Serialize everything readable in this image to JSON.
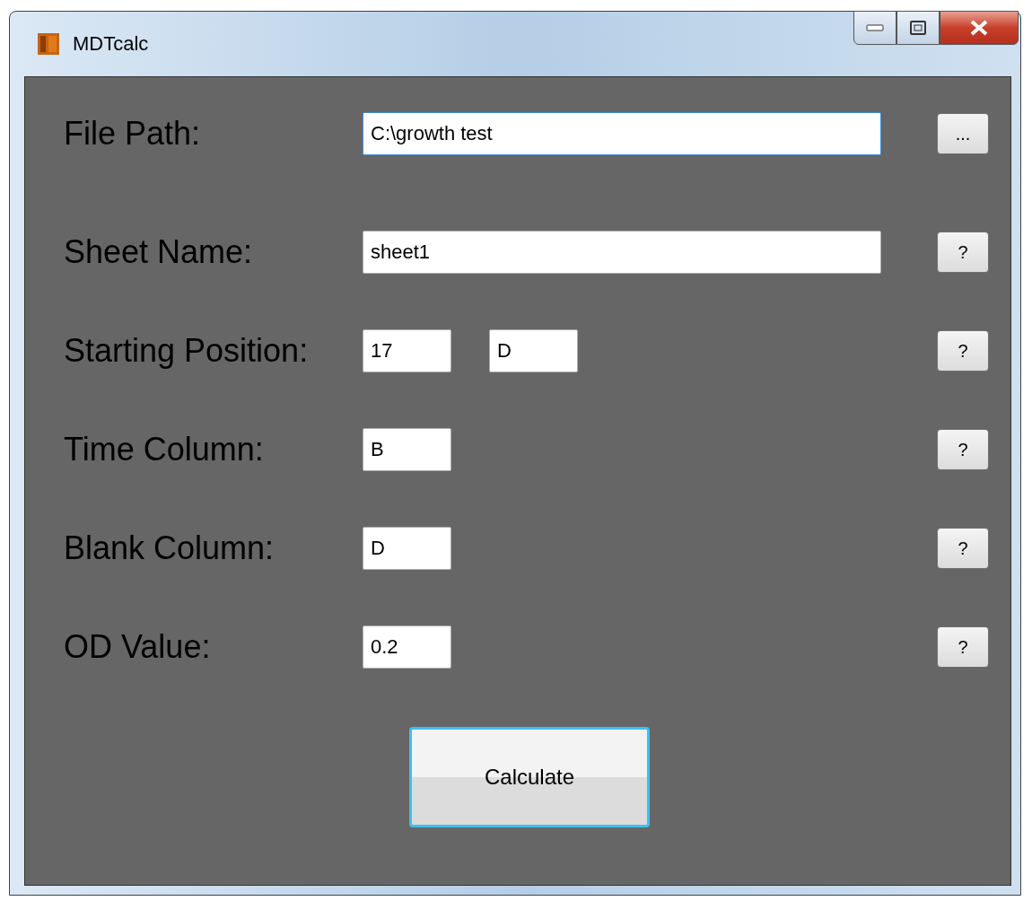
{
  "window": {
    "title": "MDTcalc"
  },
  "rows": [
    {
      "label": "File Path:",
      "fields": [
        {
          "kind": "wide",
          "value": "C:\\growth test"
        }
      ],
      "button": "..."
    },
    {
      "label": "Sheet Name:",
      "fields": [
        {
          "kind": "wide",
          "value": "sheet1"
        }
      ],
      "button": "?"
    },
    {
      "label": "Starting Position:",
      "fields": [
        {
          "kind": "small",
          "value": "17"
        },
        {
          "kind": "small",
          "value": "D"
        }
      ],
      "button": "?"
    },
    {
      "label": "Time Column:",
      "fields": [
        {
          "kind": "small",
          "value": "B"
        }
      ],
      "button": "?"
    },
    {
      "label": "Blank Column:",
      "fields": [
        {
          "kind": "small",
          "value": "D"
        }
      ],
      "button": "?"
    },
    {
      "label": "OD Value:",
      "fields": [
        {
          "kind": "small",
          "value": "0.2"
        }
      ],
      "button": "?"
    }
  ],
  "action": {
    "label": "Calculate"
  }
}
